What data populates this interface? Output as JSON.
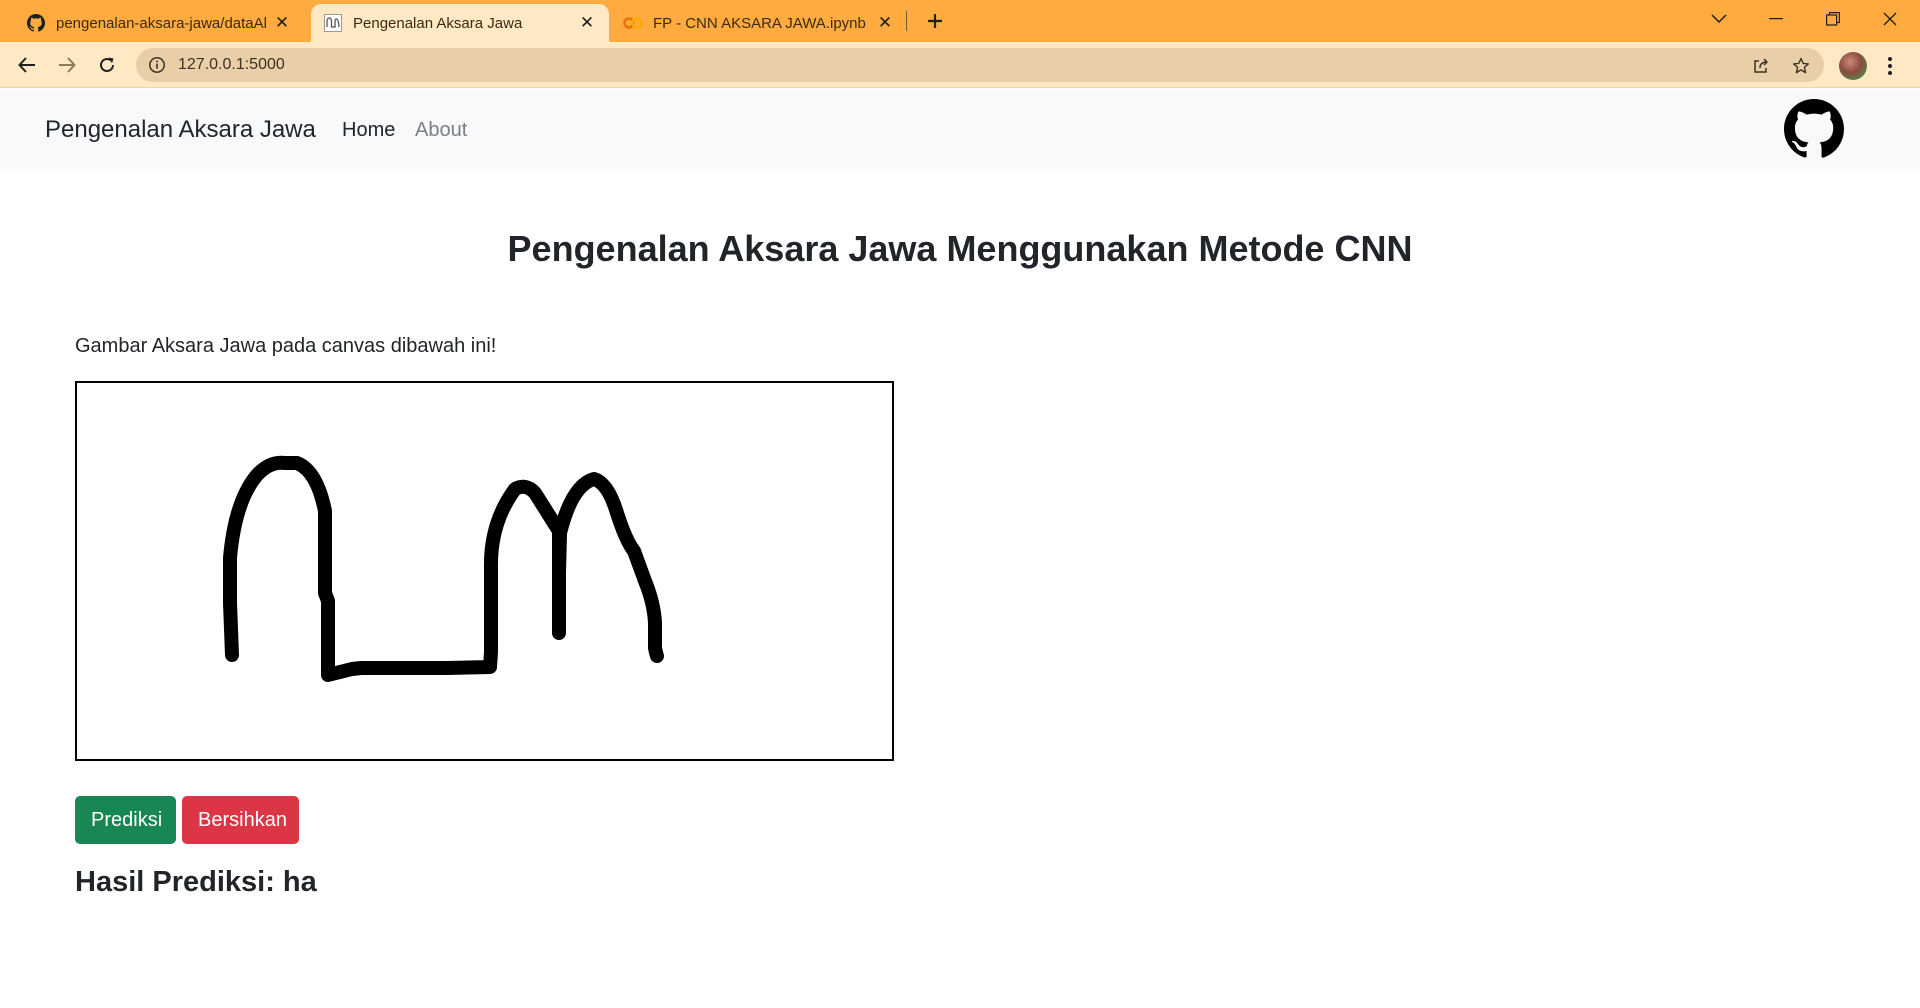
{
  "browser": {
    "tabs": [
      {
        "title": "pengenalan-aksara-jawa/dataAks",
        "favicon": "github-icon"
      },
      {
        "title": "Pengenalan Aksara Jawa",
        "favicon": "aksara-icon"
      },
      {
        "title": "FP - CNN AKSARA JAWA.ipynb - C",
        "favicon": "colab-icon"
      }
    ],
    "url": "127.0.0.1:5000",
    "theme_color": "#ffab40"
  },
  "navbar": {
    "brand": "Pengenalan Aksara Jawa",
    "links": [
      "Home",
      "About"
    ]
  },
  "main": {
    "heading": "Pengenalan Aksara Jawa Menggunakan Metode CNN",
    "instruction": "Gambar Aksara Jawa pada canvas dibawah ini!",
    "buttons": {
      "predict": "Prediksi",
      "clear": "Bersihkan"
    },
    "result_label": "Hasil Prediksi:",
    "result_value": "ha",
    "result_text": "Hasil Prediksi: ha"
  },
  "colors": {
    "success": "#198754",
    "danger": "#dc3545",
    "navbar_bg": "#f8f9fa"
  }
}
